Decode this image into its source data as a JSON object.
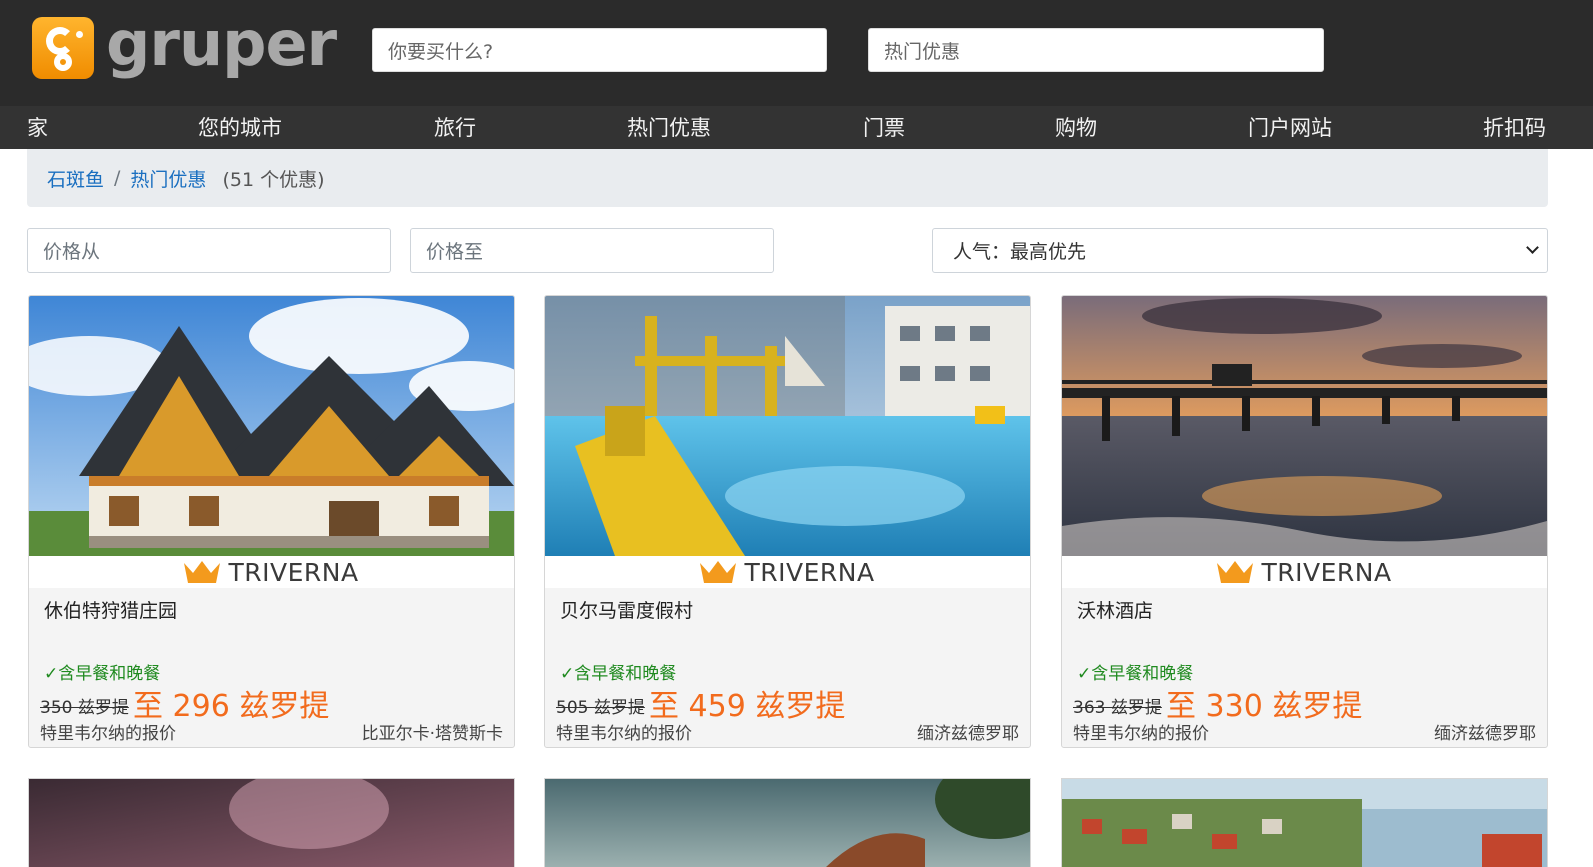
{
  "header": {
    "logo_text": "gruper",
    "search_placeholder": "你要买什么?",
    "category_placeholder": "热门优惠"
  },
  "nav": {
    "items": [
      "家",
      "您的城市",
      "旅行",
      "热门优惠",
      "门票",
      "购物",
      "门户网站",
      "折扣码"
    ]
  },
  "breadcrumb": {
    "home": "石斑鱼",
    "current": "热门优惠",
    "count": "(51 个优惠)"
  },
  "filters": {
    "price_from_placeholder": "价格从",
    "price_to_placeholder": "价格至",
    "sort_selected": "人气：最高优先"
  },
  "offers": [
    {
      "brand": "TRIVERNA",
      "title": "休伯特狩猎庄园",
      "meal": "✓含早餐和晚餐",
      "price_old": "350 兹罗提",
      "price_new": "至 296 兹罗提",
      "offer_by": "特里韦尔纳的报价",
      "location": "比亚尔卡·塔赞斯卡"
    },
    {
      "brand": "TRIVERNA",
      "title": "贝尔马雷度假村",
      "meal": "✓含早餐和晚餐",
      "price_old": "505 兹罗提",
      "price_new": "至 459 兹罗提",
      "offer_by": "特里韦尔纳的报价",
      "location": "缅济兹德罗耶"
    },
    {
      "brand": "TRIVERNA",
      "title": "沃林酒店",
      "meal": "✓含早餐和晚餐",
      "price_old": "363 兹罗提",
      "price_new": "至 330 兹罗提",
      "offer_by": "特里韦尔纳的报价",
      "location": "缅济兹德罗耶"
    }
  ],
  "colors": {
    "accent_price": "#f26b1d",
    "meal_green": "#1f8a1f",
    "link_blue": "#1a6fc0",
    "header_bg": "#2b2b2b",
    "nav_bg": "#333333"
  }
}
